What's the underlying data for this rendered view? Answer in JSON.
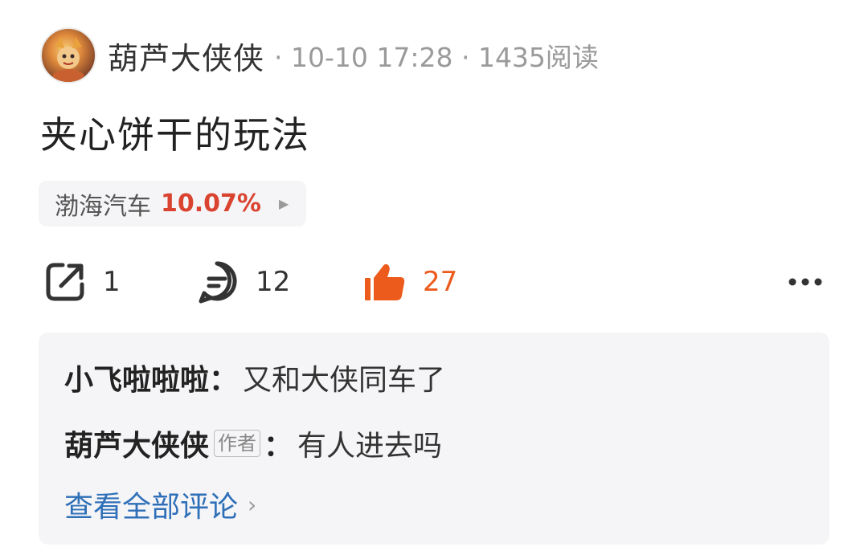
{
  "post": {
    "author": "葫芦大侠侠",
    "meta": "· 10-10 17:28 · 1435阅读",
    "title": "夹心饼干的玩法"
  },
  "stock": {
    "name": "渤海汽车",
    "change": "10.07%",
    "change_color": "#d9432f"
  },
  "actions": {
    "share_count": "1",
    "comment_count": "12",
    "like_count": "27",
    "like_color": "#ec5b1c"
  },
  "comments": {
    "items": [
      {
        "name": "小飞啦啦啦",
        "colon": "：",
        "text": "又和大侠同车了"
      },
      {
        "name": "葫芦大侠侠",
        "tag": "作者",
        "colon": "：",
        "text": "有人进去吗"
      }
    ],
    "view_all": "查看全部评论"
  }
}
